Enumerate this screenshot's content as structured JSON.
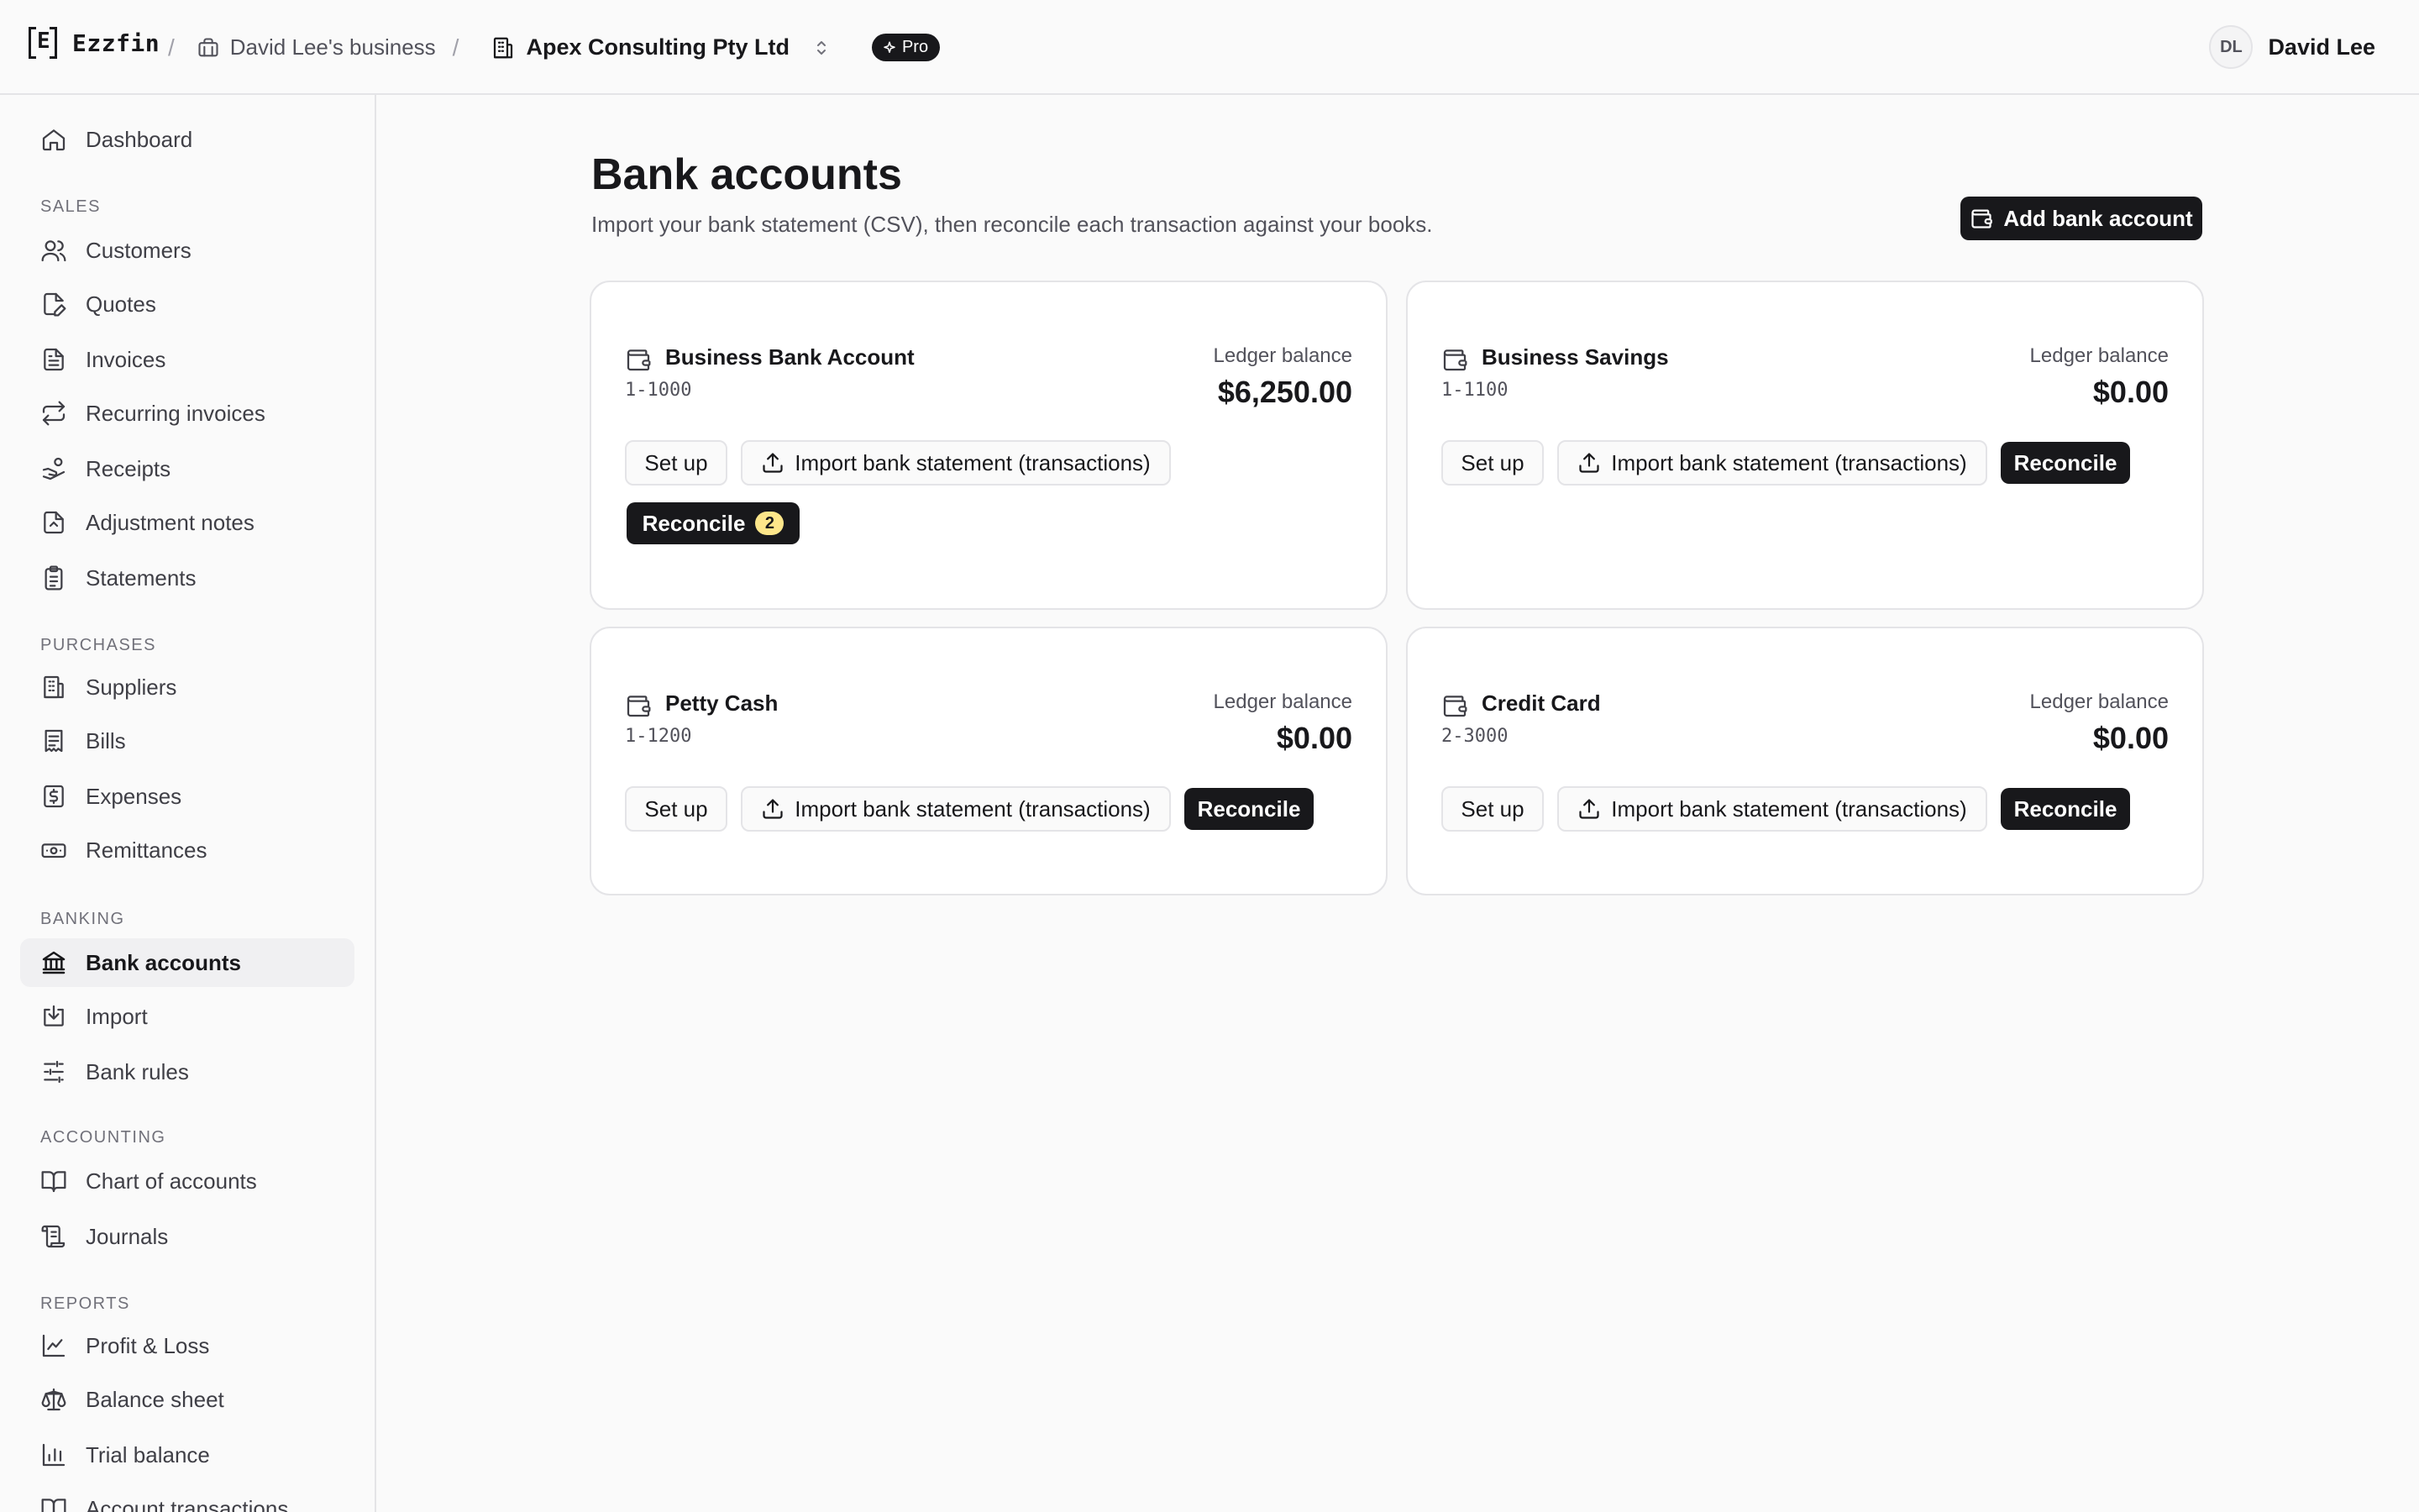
{
  "topbar": {
    "logo_text": "Ezzfin",
    "breadcrumb_business": "David Lee's business",
    "breadcrumb_org": "Apex Consulting Pty Ltd",
    "plan_badge": "Pro",
    "user_initials": "DL",
    "user_name": "David Lee"
  },
  "sidebar": {
    "dashboard": "Dashboard",
    "sections": {
      "sales": "SALES",
      "purchases": "PURCHASES",
      "banking": "BANKING",
      "accounting": "ACCOUNTING",
      "reports": "REPORTS"
    },
    "sales_items": [
      "Customers",
      "Quotes",
      "Invoices",
      "Recurring invoices",
      "Receipts",
      "Adjustment notes",
      "Statements"
    ],
    "purchases_items": [
      "Suppliers",
      "Bills",
      "Expenses",
      "Remittances"
    ],
    "banking_items": [
      "Bank accounts",
      "Import",
      "Bank rules"
    ],
    "accounting_items": [
      "Chart of accounts",
      "Journals"
    ],
    "reports_items": [
      "Profit & Loss",
      "Balance sheet",
      "Trial balance",
      "Account transactions"
    ],
    "active_item": "Bank accounts"
  },
  "main": {
    "title": "Bank accounts",
    "subtitle": "Import your bank statement (CSV), then reconcile each transaction against your books.",
    "add_button": "Add bank account"
  },
  "labels": {
    "ledger_balance": "Ledger balance",
    "setup": "Set up",
    "import": "Import bank statement (transactions)",
    "reconcile": "Reconcile"
  },
  "accounts": [
    {
      "name": "Business Bank Account",
      "code": "1-1000",
      "balance": "$6,250.00",
      "reconcile_count": "2"
    },
    {
      "name": "Business Savings",
      "code": "1-1100",
      "balance": "$0.00"
    },
    {
      "name": "Petty Cash",
      "code": "1-1200",
      "balance": "$0.00"
    },
    {
      "name": "Credit Card",
      "code": "2-3000",
      "balance": "$0.00"
    }
  ],
  "colors": {
    "accent": "#18181b",
    "badge": "#fde68a",
    "background": "#fafafa",
    "border": "#e4e4e7"
  }
}
